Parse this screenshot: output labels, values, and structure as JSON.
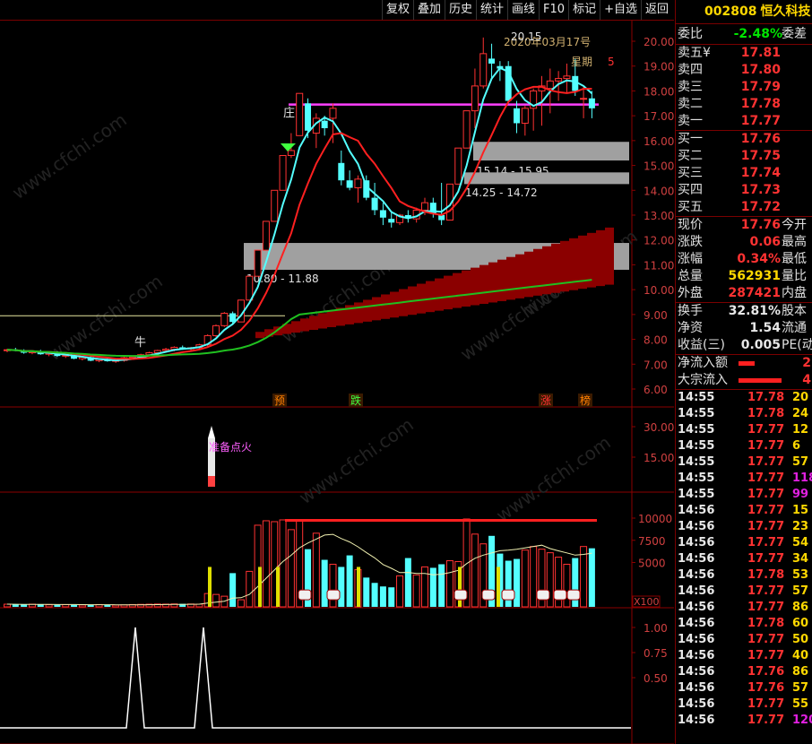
{
  "toolbar": {
    "buttons": [
      "复权",
      "叠加",
      "历史",
      "统计",
      "画线",
      "F10",
      "标记",
      "+自选",
      "返回"
    ]
  },
  "stock": {
    "code": "002808",
    "name": "恒久科技"
  },
  "quote": {
    "weibi_label": "委比",
    "weibi": "-2.48%",
    "weicha_label": "委差",
    "asks": [
      {
        "label": "卖五",
        "mark": "¥",
        "price": "17.81"
      },
      {
        "label": "卖四",
        "price": "17.80"
      },
      {
        "label": "卖三",
        "price": "17.79"
      },
      {
        "label": "卖二",
        "price": "17.78"
      },
      {
        "label": "卖一",
        "price": "17.77"
      }
    ],
    "bids": [
      {
        "label": "买一",
        "price": "17.76"
      },
      {
        "label": "买二",
        "price": "17.75"
      },
      {
        "label": "买三",
        "price": "17.74"
      },
      {
        "label": "买四",
        "price": "17.73"
      },
      {
        "label": "买五",
        "price": "17.72"
      }
    ],
    "stats1": [
      {
        "label": "现价",
        "value": "17.76",
        "color": "red",
        "label2": "今开"
      },
      {
        "label": "涨跌",
        "value": "0.06",
        "color": "red",
        "label2": "最高"
      },
      {
        "label": "涨幅",
        "value": "0.34%",
        "color": "red",
        "label2": "最低"
      },
      {
        "label": "总量",
        "value": "562931",
        "color": "yel",
        "label2": "量比"
      },
      {
        "label": "外盘",
        "value": "287421",
        "color": "red",
        "label2": "内盘"
      }
    ],
    "stats2": [
      {
        "label": "换手",
        "value": "32.81%",
        "color": "wht",
        "label2": "股本"
      },
      {
        "label": "净资",
        "value": "1.54",
        "color": "wht",
        "label2": "流通"
      },
      {
        "label": "收益(三)",
        "value": "0.005",
        "color": "wht",
        "label2": "PE(动"
      }
    ],
    "flows": [
      {
        "label": "净流入额",
        "bar_fraction": 0.3,
        "value": "2"
      },
      {
        "label": "大宗流入",
        "bar_fraction": 0.8,
        "value": "4"
      }
    ]
  },
  "ticks": [
    {
      "t": "14:55",
      "p": "17.78",
      "v": "20",
      "c": "yel"
    },
    {
      "t": "14:55",
      "p": "17.78",
      "v": "24",
      "c": "yel"
    },
    {
      "t": "14:55",
      "p": "17.77",
      "v": "12",
      "c": "yel"
    },
    {
      "t": "14:55",
      "p": "17.77",
      "v": "6",
      "c": "yel"
    },
    {
      "t": "14:55",
      "p": "17.77",
      "v": "57",
      "c": "yel"
    },
    {
      "t": "14:55",
      "p": "17.77",
      "v": "118",
      "c": "mag"
    },
    {
      "t": "14:55",
      "p": "17.77",
      "v": "99",
      "c": "mag"
    },
    {
      "t": "14:56",
      "p": "17.77",
      "v": "15",
      "c": "yel"
    },
    {
      "t": "14:56",
      "p": "17.77",
      "v": "23",
      "c": "yel"
    },
    {
      "t": "14:56",
      "p": "17.77",
      "v": "54",
      "c": "yel"
    },
    {
      "t": "14:56",
      "p": "17.77",
      "v": "34",
      "c": "yel"
    },
    {
      "t": "14:56",
      "p": "17.78",
      "v": "53",
      "c": "yel"
    },
    {
      "t": "14:56",
      "p": "17.77",
      "v": "57",
      "c": "yel"
    },
    {
      "t": "14:56",
      "p": "17.77",
      "v": "86",
      "c": "yel"
    },
    {
      "t": "14:56",
      "p": "17.78",
      "v": "60",
      "c": "yel"
    },
    {
      "t": "14:56",
      "p": "17.77",
      "v": "50",
      "c": "yel"
    },
    {
      "t": "14:56",
      "p": "17.77",
      "v": "40",
      "c": "yel"
    },
    {
      "t": "14:56",
      "p": "17.76",
      "v": "86",
      "c": "yel"
    },
    {
      "t": "14:56",
      "p": "17.76",
      "v": "57",
      "c": "yel"
    },
    {
      "t": "14:56",
      "p": "17.77",
      "v": "55",
      "c": "yel"
    },
    {
      "t": "14:56",
      "p": "17.77",
      "v": "120",
      "c": "mag"
    }
  ],
  "chart_labels": {
    "date": "2020年03月17号",
    "weekday": "星期",
    "weekday_num": "5",
    "price_high": "20.15",
    "zone1": "15.14 - 15.95",
    "zone2": "14.25 - 14.72",
    "zone3": "10.80 - 11.88",
    "mark_niu": "牛",
    "mark_zhuang": "庄",
    "signals": [
      "预",
      "跌",
      "涨",
      "榜"
    ],
    "rocket": "准备点火",
    "vol_unit": "X100",
    "watermark": "www.cfchi.com",
    "price_axis": [
      "20.00",
      "19.00",
      "18.00",
      "17.00",
      "16.00",
      "15.00",
      "14.00",
      "13.00",
      "12.00",
      "11.00",
      "10.00",
      "9.00",
      "8.00",
      "7.00",
      "6.00"
    ],
    "ind_axis": [
      "30.00",
      "15.00"
    ],
    "vol_axis": [
      "10000",
      "7500",
      "5000"
    ],
    "osc_axis": [
      "1.00",
      "0.75",
      "0.50"
    ]
  },
  "chart_data": {
    "type": "candlestick",
    "candles": [
      [
        7.55,
        7.62,
        7.48,
        7.58
      ],
      [
        7.58,
        7.66,
        7.52,
        7.55
      ],
      [
        7.55,
        7.6,
        7.42,
        7.46
      ],
      [
        7.46,
        7.55,
        7.4,
        7.52
      ],
      [
        7.52,
        7.58,
        7.38,
        7.4
      ],
      [
        7.4,
        7.48,
        7.32,
        7.45
      ],
      [
        7.45,
        7.52,
        7.3,
        7.33
      ],
      [
        7.33,
        7.4,
        7.25,
        7.36
      ],
      [
        7.36,
        7.45,
        7.2,
        7.22
      ],
      [
        7.22,
        7.3,
        7.15,
        7.28
      ],
      [
        7.28,
        7.32,
        7.12,
        7.14
      ],
      [
        7.14,
        7.22,
        7.08,
        7.2
      ],
      [
        7.2,
        7.28,
        7.1,
        7.12
      ],
      [
        7.12,
        7.18,
        7.05,
        7.15
      ],
      [
        7.15,
        7.3,
        7.1,
        7.26
      ],
      [
        7.26,
        7.35,
        7.18,
        7.3
      ],
      [
        7.3,
        7.42,
        7.25,
        7.38
      ],
      [
        7.38,
        7.5,
        7.32,
        7.46
      ],
      [
        7.46,
        7.58,
        7.4,
        7.55
      ],
      [
        7.55,
        7.66,
        7.48,
        7.6
      ],
      [
        7.6,
        7.72,
        7.52,
        7.68
      ],
      [
        7.68,
        7.75,
        7.58,
        7.62
      ],
      [
        7.62,
        7.7,
        7.55,
        7.66
      ],
      [
        7.66,
        7.82,
        7.6,
        7.78
      ],
      [
        7.78,
        8.2,
        7.72,
        8.15
      ],
      [
        8.15,
        8.6,
        8.1,
        8.55
      ],
      [
        8.55,
        9.1,
        8.5,
        9.05
      ],
      [
        9.05,
        9.12,
        8.6,
        8.7
      ],
      [
        8.7,
        9.6,
        8.7,
        9.58
      ],
      [
        9.58,
        10.55,
        9.58,
        10.54
      ],
      [
        10.54,
        11.6,
        10.54,
        11.59
      ],
      [
        11.59,
        12.75,
        11.6,
        12.75
      ],
      [
        12.75,
        14.0,
        12.9,
        14.0
      ],
      [
        14.0,
        15.4,
        14.0,
        15.4
      ],
      [
        15.4,
        16.3,
        15.3,
        15.6
      ],
      [
        16.2,
        17.9,
        16.2,
        17.9
      ],
      [
        17.5,
        17.7,
        16.1,
        16.4
      ],
      [
        16.3,
        17.1,
        15.7,
        16.9
      ],
      [
        16.8,
        17.0,
        16.2,
        16.5
      ],
      [
        16.9,
        17.5,
        15.9,
        17.3
      ],
      [
        15.1,
        15.6,
        14.2,
        14.4
      ],
      [
        14.4,
        14.8,
        14.0,
        14.1
      ],
      [
        14.1,
        14.6,
        13.5,
        14.45
      ],
      [
        14.4,
        14.6,
        13.6,
        13.7
      ],
      [
        13.7,
        14.3,
        13.0,
        13.2
      ],
      [
        13.2,
        13.5,
        12.6,
        12.9
      ],
      [
        12.85,
        13.1,
        12.5,
        12.7
      ],
      [
        12.7,
        13.05,
        12.6,
        13.0
      ],
      [
        13.0,
        13.2,
        12.7,
        12.9
      ],
      [
        12.85,
        13.3,
        12.7,
        13.2
      ],
      [
        13.2,
        13.7,
        13.0,
        13.5
      ],
      [
        13.5,
        13.7,
        12.9,
        13.05
      ],
      [
        13.0,
        14.3,
        12.6,
        12.8
      ],
      [
        12.8,
        14.25,
        12.8,
        14.25
      ],
      [
        14.25,
        15.7,
        14.25,
        15.7
      ],
      [
        15.7,
        17.2,
        15.7,
        17.2
      ],
      [
        17.2,
        18.9,
        16.5,
        18.2
      ],
      [
        18.2,
        20.15,
        18.1,
        19.5
      ],
      [
        19.3,
        19.9,
        18.5,
        19.1
      ],
      [
        19.0,
        19.2,
        18.4,
        18.9
      ],
      [
        19.0,
        19.2,
        17.5,
        17.6
      ],
      [
        17.3,
        17.6,
        16.3,
        16.7
      ],
      [
        16.7,
        17.4,
        16.2,
        17.3
      ],
      [
        17.3,
        18.1,
        16.4,
        18.0
      ],
      [
        18.0,
        18.6,
        16.6,
        18.2
      ],
      [
        18.1,
        18.9,
        17.1,
        18.4
      ],
      [
        18.4,
        18.8,
        17.6,
        18.5
      ],
      [
        18.5,
        19.1,
        17.9,
        18.6
      ],
      [
        18.6,
        19.3,
        17.8,
        18.0
      ],
      [
        17.7,
        18.2,
        16.9,
        17.7
      ],
      [
        17.7,
        18.0,
        16.9,
        17.3
      ]
    ],
    "ylim": [
      6.0,
      20.5
    ]
  }
}
